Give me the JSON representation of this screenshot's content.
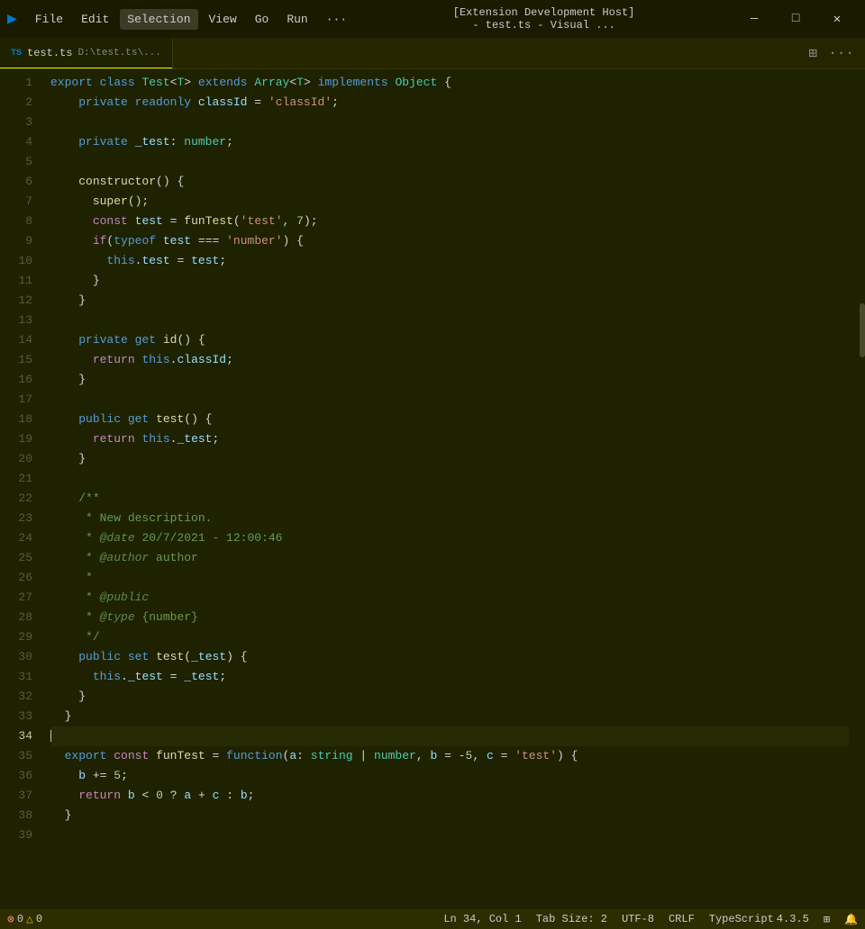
{
  "titlebar": {
    "logo": "▶",
    "menu": [
      "File",
      "Edit",
      "Selection",
      "View",
      "Go",
      "Run",
      "···"
    ],
    "title": "[Extension Development Host] - test.ts - Visual ...",
    "win_minimize": "—",
    "win_maximize": "□",
    "win_close": "✕"
  },
  "tab": {
    "icon": "TS",
    "filename": "test.ts",
    "filepath": "D:\\test.ts\\...",
    "action_split": "⊞",
    "action_more": "···"
  },
  "lines": [
    {
      "n": 1,
      "active": false
    },
    {
      "n": 2,
      "active": false
    },
    {
      "n": 3,
      "active": false
    },
    {
      "n": 4,
      "active": false
    },
    {
      "n": 5,
      "active": false
    },
    {
      "n": 6,
      "active": false
    },
    {
      "n": 7,
      "active": false
    },
    {
      "n": 8,
      "active": false
    },
    {
      "n": 9,
      "active": false
    },
    {
      "n": 10,
      "active": false
    },
    {
      "n": 11,
      "active": false
    },
    {
      "n": 12,
      "active": false
    },
    {
      "n": 13,
      "active": false
    },
    {
      "n": 14,
      "active": false
    },
    {
      "n": 15,
      "active": false
    },
    {
      "n": 16,
      "active": false
    },
    {
      "n": 17,
      "active": false
    },
    {
      "n": 18,
      "active": false
    },
    {
      "n": 19,
      "active": false
    },
    {
      "n": 20,
      "active": false
    },
    {
      "n": 21,
      "active": false
    },
    {
      "n": 22,
      "active": false
    },
    {
      "n": 23,
      "active": false
    },
    {
      "n": 24,
      "active": false
    },
    {
      "n": 25,
      "active": false
    },
    {
      "n": 26,
      "active": false
    },
    {
      "n": 27,
      "active": false
    },
    {
      "n": 28,
      "active": false
    },
    {
      "n": 29,
      "active": false
    },
    {
      "n": 30,
      "active": false
    },
    {
      "n": 31,
      "active": false
    },
    {
      "n": 32,
      "active": false
    },
    {
      "n": 33,
      "active": false
    },
    {
      "n": 34,
      "active": true
    },
    {
      "n": 35,
      "active": false
    },
    {
      "n": 36,
      "active": false
    },
    {
      "n": 37,
      "active": false
    },
    {
      "n": 38,
      "active": false
    },
    {
      "n": 39,
      "active": false
    }
  ],
  "statusbar": {
    "errors": "0",
    "warnings": "0",
    "position": "Ln 34, Col 1",
    "tab_size": "Tab Size: 2",
    "encoding": "UTF-8",
    "line_ending": "CRLF",
    "language": "TypeScript",
    "version": "4.3.5",
    "remote_icon": "⊞",
    "bell_icon": "🔔"
  }
}
